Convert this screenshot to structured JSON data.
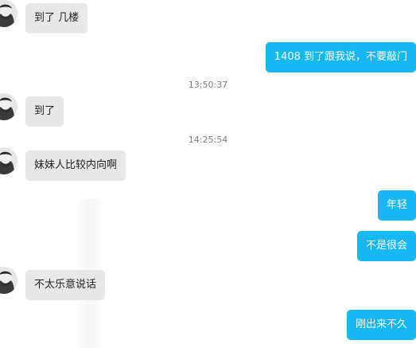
{
  "messages": [
    {
      "from": "contact",
      "text": "到了 几楼"
    },
    {
      "from": "me",
      "text": "1408 到了跟我说，不要敲门"
    },
    {
      "type": "time",
      "text": "13:50:37"
    },
    {
      "from": "contact",
      "text": "到了"
    },
    {
      "type": "time",
      "text": "14:25:54"
    },
    {
      "from": "contact",
      "text": "妹妹人比较内向啊"
    },
    {
      "from": "me",
      "text": "年轻"
    },
    {
      "from": "me",
      "text": "不是很会"
    },
    {
      "from": "contact",
      "text": "不太乐意说话"
    },
    {
      "from": "me",
      "text": "刚出来不久"
    }
  ],
  "colors": {
    "outgoing_bubble": "#16b8f3",
    "incoming_bubble": "#e8e8e9",
    "timestamp_text": "#7c7c7c"
  },
  "icons": {
    "avatar": "contact-avatar-icon"
  }
}
